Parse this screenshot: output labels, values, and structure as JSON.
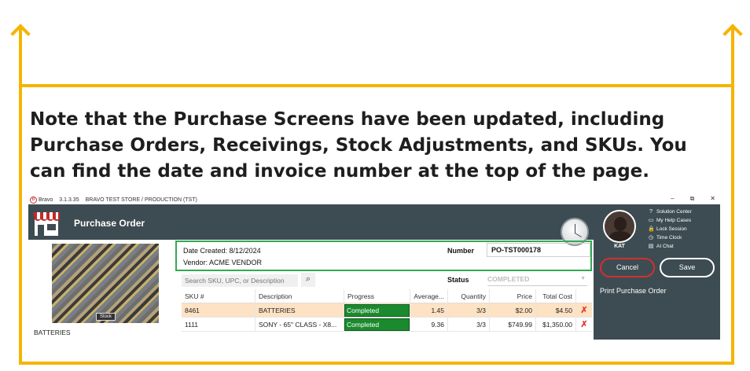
{
  "note": "Note that the Purchase Screens have been updated, including Purchase Orders, Receivings, Stock Adjustments, and SKUs. You can find the date and invoice number at the top of the page.",
  "colors": {
    "annotation": "#f5b400",
    "header_bg": "#3d4c52",
    "highlight_box": "#34a853",
    "progress_green": "#1b8a2e",
    "selected_row": "#fde2c3",
    "delete_red": "#e53935"
  },
  "window": {
    "app_name": "Bravo",
    "version": "3.1.3.35",
    "store": "BRAVO TEST STORE / PRODUCTION (TST)",
    "min": "–",
    "restore": "⧉",
    "close": "✕"
  },
  "header": {
    "title": "Purchase Order"
  },
  "product": {
    "name": "BATTERIES",
    "badge": "Stock"
  },
  "info": {
    "date_label": "Date Created:",
    "date_value": "8/12/2024",
    "vendor_label": "Vendor:",
    "vendor_value": "ACME VENDOR",
    "number_label": "Number",
    "number_value": "PO-TST000178"
  },
  "search": {
    "placeholder": "Search SKU, UPC, or Description",
    "icon": "search-icon"
  },
  "status": {
    "label": "Status",
    "value": "COMPLETED"
  },
  "table": {
    "headers": [
      "SKU #",
      "Description",
      "Progress",
      "Average...",
      "Quantity",
      "Price",
      "Total Cost"
    ],
    "rows": [
      {
        "sku": "8461",
        "description": "BATTERIES",
        "progress": "Completed",
        "average": "1.45",
        "quantity": "3/3",
        "price": "$2.00",
        "total": "$4.50"
      },
      {
        "sku": "1111",
        "description": "SONY - 65\" CLASS - X8...",
        "progress": "Completed",
        "average": "9.36",
        "quantity": "3/3",
        "price": "$749.99",
        "total": "$1,350.00"
      }
    ]
  },
  "user": {
    "name": "KAT"
  },
  "side_links": [
    {
      "icon": "help-icon",
      "glyph": "?",
      "label": "Solution Center"
    },
    {
      "icon": "help-cases-icon",
      "glyph": "▭",
      "label": "My Help Cases"
    },
    {
      "icon": "lock-icon",
      "glyph": "🔒",
      "label": "Lock Session"
    },
    {
      "icon": "clock-icon",
      "glyph": "◷",
      "label": "Time Clock"
    },
    {
      "icon": "chat-icon",
      "glyph": "▤",
      "label": "AI Chat"
    }
  ],
  "buttons": {
    "cancel": "Cancel",
    "save": "Save",
    "print": "Print Purchase Order"
  }
}
